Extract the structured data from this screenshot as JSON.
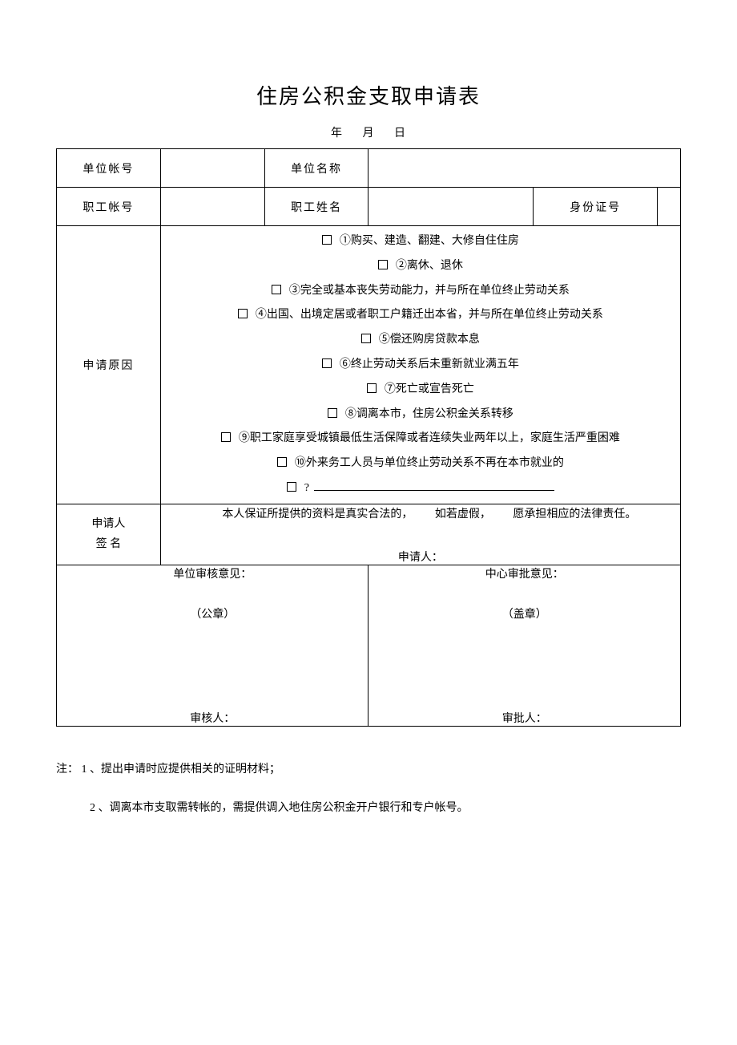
{
  "title": "住房公积金支取申请表",
  "date": {
    "year_label": "年",
    "month_label": "月",
    "day_label": "日"
  },
  "row1": {
    "unit_account_label": "单位帐号",
    "unit_account_value": "",
    "unit_name_label": "单位名称",
    "unit_name_value": ""
  },
  "row2": {
    "worker_account_label": "职工帐号",
    "worker_account_value": "",
    "worker_name_label": "职工姓名",
    "worker_name_value": "",
    "id_label": "身份证号",
    "id_value": ""
  },
  "reason": {
    "label": "申请原因",
    "items": [
      "①购买、建造、翻建、大修自住住房",
      "②离休、退休",
      "③完全或基本丧失劳动能力，并与所在单位终止劳动关系",
      "④出国、出境定居或者职工户籍迁出本省，并与所在单位终止劳动关系",
      "⑤偿还购房贷款本息",
      "⑥终止劳动关系后未重新就业满五年",
      "⑦死亡或宣告死亡",
      "⑧调离本市，住房公积金关系转移",
      "⑨职工家庭享受城镇最低生活保障或者连续失业两年以上，家庭生活严重困难",
      "⑩外来务工人员与单位终止劳动关系不再在本市就业的"
    ],
    "other_prefix": "?"
  },
  "signature": {
    "label_line1": "申请人",
    "label_line2": "签 名",
    "statement_part1": "本人保证所提供的资料是真实合法的，",
    "statement_part2": "如若虚假，",
    "statement_part3": "愿承担相应的法律责任。",
    "applicant_label": "申请人："
  },
  "approval": {
    "unit_title": "单位审核意见：",
    "unit_seal": "（公章）",
    "unit_reviewer": "审核人：",
    "center_title": "中心审批意见：",
    "center_seal": "（盖章）",
    "center_reviewer": "审批人："
  },
  "notes": {
    "line1": "注： 1 、提出申请时应提供相关的证明材料；",
    "line2": "2 、调离本市支取需转帐的，需提供调入地住房公积金开户银行和专户帐号。"
  }
}
